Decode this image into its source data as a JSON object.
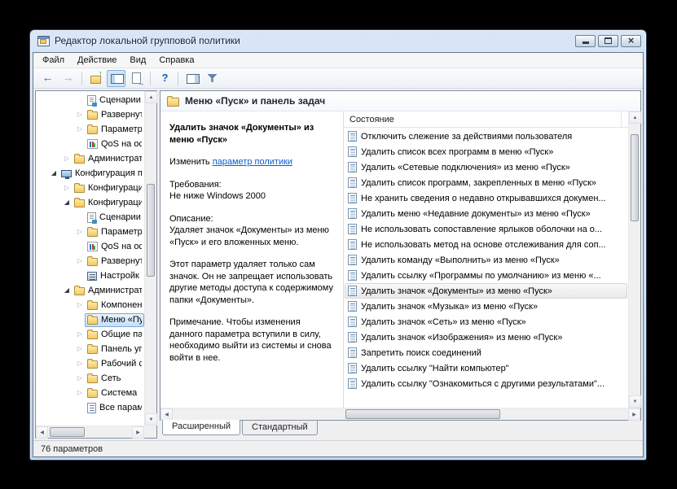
{
  "window": {
    "title": "Редактор локальной групповой политики"
  },
  "menu_bar": {
    "items": [
      "Файл",
      "Действие",
      "Вид",
      "Справка"
    ]
  },
  "toolbar": {
    "buttons": [
      {
        "name": "back"
      },
      {
        "name": "forward"
      },
      {
        "name": "up-level"
      },
      {
        "name": "show-console-tree",
        "pressed": true
      },
      {
        "name": "export-list"
      },
      {
        "name": "help"
      },
      {
        "name": "show-action-pane"
      },
      {
        "name": "filter"
      }
    ]
  },
  "tree": {
    "items": [
      {
        "label": "Сценарии",
        "level": 3,
        "icon": "script",
        "expander": ""
      },
      {
        "label": "Развернут",
        "level": 3,
        "icon": "folder",
        "expander": "collapsed"
      },
      {
        "label": "Параметр",
        "level": 3,
        "icon": "folder",
        "expander": "collapsed"
      },
      {
        "label": "QoS на ос",
        "level": 3,
        "icon": "chart",
        "expander": ""
      },
      {
        "label": "Администрат",
        "level": 2,
        "icon": "folder",
        "expander": "collapsed"
      },
      {
        "label": "Конфигурация п",
        "level": 1,
        "icon": "computer",
        "expander": "expanded"
      },
      {
        "label": "Конфигураци",
        "level": 2,
        "icon": "folder",
        "expander": "collapsed"
      },
      {
        "label": "Конфигураци",
        "level": 2,
        "icon": "folder",
        "expander": "expanded"
      },
      {
        "label": "Сценарии",
        "level": 3,
        "icon": "script",
        "expander": ""
      },
      {
        "label": "Параметр",
        "level": 3,
        "icon": "folder",
        "expander": "collapsed"
      },
      {
        "label": "QoS на ос",
        "level": 3,
        "icon": "chart",
        "expander": ""
      },
      {
        "label": "Развернут",
        "level": 3,
        "icon": "folder",
        "expander": "collapsed"
      },
      {
        "label": "Настройк",
        "level": 3,
        "icon": "settings",
        "expander": ""
      },
      {
        "label": "Администрат",
        "level": 2,
        "icon": "folder",
        "expander": "expanded"
      },
      {
        "label": "Компонент",
        "level": 3,
        "icon": "folder",
        "expander": "collapsed"
      },
      {
        "label": "Меню «Пу",
        "level": 3,
        "icon": "folder",
        "expander": "",
        "selected": true
      },
      {
        "label": "Общие па",
        "level": 3,
        "icon": "folder",
        "expander": "collapsed"
      },
      {
        "label": "Панель уп",
        "level": 3,
        "icon": "folder",
        "expander": "collapsed"
      },
      {
        "label": "Рабочий ст",
        "level": 3,
        "icon": "folder",
        "expander": "collapsed"
      },
      {
        "label": "Сеть",
        "level": 3,
        "icon": "folder",
        "expander": "collapsed"
      },
      {
        "label": "Система",
        "level": 3,
        "icon": "folder",
        "expander": "collapsed"
      },
      {
        "label": "Все парам",
        "level": 3,
        "icon": "list",
        "expander": ""
      }
    ]
  },
  "content": {
    "header": "Меню «Пуск» и панель задач",
    "detail": {
      "title": "Удалить значок «Документы» из меню «Пуск»",
      "edit_prefix": "Изменить ",
      "edit_link": "параметр политики",
      "requirements_label": "Требования:",
      "requirements_value": "Не ниже Windows 2000",
      "description_label": "Описание:",
      "paragraph1": "Удаляет значок «Документы» из меню «Пуск» и его вложенных меню.",
      "paragraph2": "Этот параметр удаляет только сам значок. Он не запрещает использовать другие методы доступа к содержимому папки «Документы».",
      "note": "Примечание. Чтобы изменения данного параметра вступили в силу, необходимо выйти из системы и снова войти в нее."
    },
    "list": {
      "column_header": "Состояние",
      "selected_index": 10,
      "items": [
        "Отключить слежение за действиями пользователя",
        "Удалить список всех программ в меню «Пуск»",
        "Удалить «Сетевые подключения» из меню «Пуск»",
        "Удалить список программ, закрепленных в меню «Пуск»",
        "Не хранить сведения о недавно открывавшихся докумен...",
        "Удалить меню «Недавние документы» из меню «Пуск»",
        "Не использовать сопоставление ярлыков оболочки на о...",
        "Не использовать метод на основе отслеживания для соп...",
        "Удалить команду «Выполнить» из меню «Пуск»",
        "Удалить ссылку «Программы по умолчанию» из меню «...",
        "Удалить значок «Документы» из меню «Пуск»",
        "Удалить значок «Музыка» из меню «Пуск»",
        "Удалить значок «Сеть» из меню «Пуск»",
        "Удалить значок «Изображения» из меню «Пуск»",
        "Запретить поиск соединений",
        "Удалить ссылку \"Найти компьютер\"",
        "Удалить ссылку \"Ознакомиться с другими результатами\"..."
      ]
    },
    "tabs": [
      {
        "label": "Расширенный",
        "active": true
      },
      {
        "label": "Стандартный",
        "active": false
      }
    ]
  },
  "status_bar": {
    "text": "76 параметров"
  }
}
